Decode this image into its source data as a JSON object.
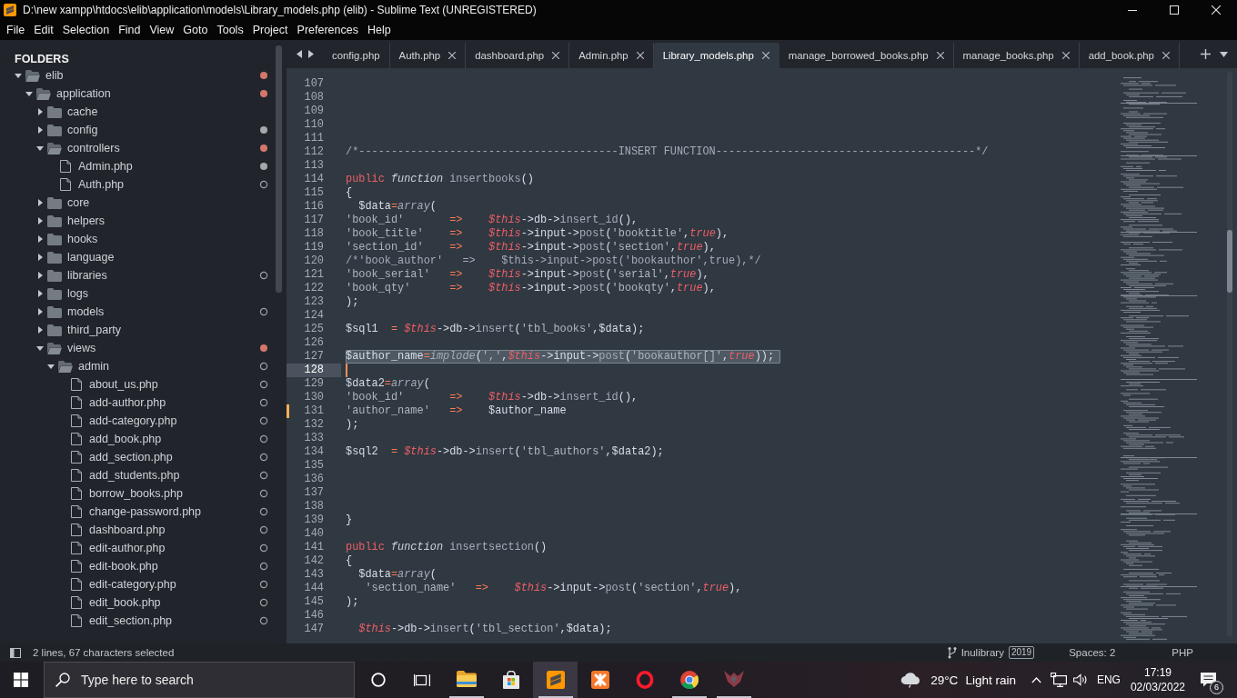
{
  "window": {
    "title": "D:\\new xampp\\htdocs\\elib\\application\\models\\Library_models.php (elib) - Sublime Text (UNREGISTERED)"
  },
  "menu": [
    "File",
    "Edit",
    "Selection",
    "Find",
    "View",
    "Goto",
    "Tools",
    "Project",
    "Preferences",
    "Help"
  ],
  "sidebar": {
    "title": "FOLDERS",
    "tree": [
      {
        "label": "elib",
        "kind": "folder",
        "expanded": true,
        "status_dot": {
          "color": "#d3776b",
          "filled": true
        },
        "children": [
          {
            "label": "application",
            "kind": "folder",
            "expanded": true,
            "status_dot": {
              "color": "#d3776b",
              "filled": true
            },
            "children": [
              {
                "label": "cache",
                "kind": "folder",
                "expanded": false
              },
              {
                "label": "config",
                "kind": "folder",
                "expanded": false,
                "status_dot": {
                  "color": "#a4a8ac",
                  "filled": true
                }
              },
              {
                "label": "controllers",
                "kind": "folder",
                "expanded": true,
                "status_dot": {
                  "color": "#d3776b",
                  "filled": true
                },
                "children": [
                  {
                    "label": "Admin.php",
                    "kind": "file",
                    "status_dot": {
                      "color": "#a4a8ac",
                      "filled": true
                    }
                  },
                  {
                    "label": "Auth.php",
                    "kind": "file",
                    "status_dot": {
                      "color": "#9aa0a6",
                      "filled": false
                    }
                  }
                ]
              },
              {
                "label": "core",
                "kind": "folder",
                "expanded": false
              },
              {
                "label": "helpers",
                "kind": "folder",
                "expanded": false
              },
              {
                "label": "hooks",
                "kind": "folder",
                "expanded": false
              },
              {
                "label": "language",
                "kind": "folder",
                "expanded": false
              },
              {
                "label": "libraries",
                "kind": "folder",
                "expanded": false,
                "status_dot": {
                  "color": "#9aa0a6",
                  "filled": false
                }
              },
              {
                "label": "logs",
                "kind": "folder",
                "expanded": false
              },
              {
                "label": "models",
                "kind": "folder",
                "expanded": false,
                "status_dot": {
                  "color": "#9aa0a6",
                  "filled": false
                }
              },
              {
                "label": "third_party",
                "kind": "folder",
                "expanded": false
              },
              {
                "label": "views",
                "kind": "folder",
                "expanded": true,
                "status_dot": {
                  "color": "#d3776b",
                  "filled": true
                },
                "children": [
                  {
                    "label": "admin",
                    "kind": "folder",
                    "expanded": true,
                    "status_dot": {
                      "color": "#9aa0a6",
                      "filled": false
                    },
                    "children": [
                      {
                        "label": "about_us.php",
                        "kind": "file",
                        "status_dot": {
                          "color": "#9aa0a6",
                          "filled": false
                        }
                      },
                      {
                        "label": "add-author.php",
                        "kind": "file",
                        "status_dot": {
                          "color": "#9aa0a6",
                          "filled": false
                        }
                      },
                      {
                        "label": "add-category.php",
                        "kind": "file",
                        "status_dot": {
                          "color": "#9aa0a6",
                          "filled": false
                        }
                      },
                      {
                        "label": "add_book.php",
                        "kind": "file",
                        "status_dot": {
                          "color": "#9aa0a6",
                          "filled": false
                        }
                      },
                      {
                        "label": "add_section.php",
                        "kind": "file",
                        "status_dot": {
                          "color": "#9aa0a6",
                          "filled": false
                        }
                      },
                      {
                        "label": "add_students.php",
                        "kind": "file",
                        "status_dot": {
                          "color": "#9aa0a6",
                          "filled": false
                        }
                      },
                      {
                        "label": "borrow_books.php",
                        "kind": "file",
                        "status_dot": {
                          "color": "#9aa0a6",
                          "filled": false
                        }
                      },
                      {
                        "label": "change-password.php",
                        "kind": "file",
                        "status_dot": {
                          "color": "#9aa0a6",
                          "filled": false
                        }
                      },
                      {
                        "label": "dashboard.php",
                        "kind": "file",
                        "status_dot": {
                          "color": "#9aa0a6",
                          "filled": false
                        }
                      },
                      {
                        "label": "edit-author.php",
                        "kind": "file",
                        "status_dot": {
                          "color": "#9aa0a6",
                          "filled": false
                        }
                      },
                      {
                        "label": "edit-book.php",
                        "kind": "file",
                        "status_dot": {
                          "color": "#9aa0a6",
                          "filled": false
                        }
                      },
                      {
                        "label": "edit-category.php",
                        "kind": "file",
                        "status_dot": {
                          "color": "#9aa0a6",
                          "filled": false
                        }
                      },
                      {
                        "label": "edit_book.php",
                        "kind": "file",
                        "status_dot": {
                          "color": "#9aa0a6",
                          "filled": false
                        }
                      },
                      {
                        "label": "edit_section.php",
                        "kind": "file",
                        "status_dot": {
                          "color": "#9aa0a6",
                          "filled": false
                        }
                      }
                    ]
                  }
                ]
              }
            ]
          }
        ]
      }
    ]
  },
  "tabs": [
    {
      "label": "config.php",
      "selected": false,
      "close_button": false
    },
    {
      "label": "Auth.php",
      "selected": false,
      "close_button": true
    },
    {
      "label": "dashboard.php",
      "selected": false,
      "close_button": true
    },
    {
      "label": "Admin.php",
      "selected": false,
      "close_button": true
    },
    {
      "label": "Library_models.php",
      "selected": true,
      "close_button": true
    },
    {
      "label": "manage_borrowed_books.php",
      "selected": false,
      "close_button": true
    },
    {
      "label": "manage_books.php",
      "selected": false,
      "close_button": true
    },
    {
      "label": "add_book.php",
      "selected": false,
      "close_button": true
    }
  ],
  "editor": {
    "lines": [
      {
        "number": "107",
        "selected": false,
        "caret": false,
        "modified": false
      },
      {
        "number": "108",
        "selected": false,
        "caret": false,
        "modified": false
      },
      {
        "number": "109",
        "selected": false,
        "caret": false,
        "modified": false
      },
      {
        "number": "110",
        "selected": false,
        "caret": false,
        "modified": false
      },
      {
        "number": "111",
        "selected": false,
        "caret": false,
        "modified": false
      },
      {
        "number": "112",
        "selected": false,
        "caret": false,
        "modified": false,
        "tokens": [
          {
            "text": "/*----------------------------------------INSERT FUNCTION----------------------------------------*/",
            "kind": "comment"
          }
        ]
      },
      {
        "number": "113",
        "selected": false,
        "caret": false,
        "modified": false
      },
      {
        "number": "114",
        "selected": false,
        "caret": false,
        "modified": false,
        "tokens": [
          {
            "text": "public ",
            "kind": "keyword"
          },
          {
            "text": "function ",
            "kind": "storage"
          },
          {
            "text": "insertbooks",
            "kind": "entity"
          },
          {
            "text": "()",
            "kind": "plain"
          }
        ]
      },
      {
        "number": "115",
        "selected": false,
        "caret": false,
        "modified": false,
        "tokens": [
          {
            "text": "{",
            "kind": "plain"
          }
        ]
      },
      {
        "number": "116",
        "selected": false,
        "caret": false,
        "modified": false,
        "tokens": [
          {
            "text": "  $data",
            "kind": "plain"
          },
          {
            "text": "=",
            "kind": "operator"
          },
          {
            "text": "array",
            "kind": "support"
          },
          {
            "text": "(",
            "kind": "plain"
          }
        ]
      },
      {
        "number": "117",
        "selected": false,
        "caret": false,
        "modified": false,
        "tokens": [
          {
            "text": "'book_id'       ",
            "kind": "string"
          },
          {
            "text": "=>    ",
            "kind": "operator"
          },
          {
            "text": "$this",
            "kind": "this"
          },
          {
            "text": "->db->",
            "kind": "plain"
          },
          {
            "text": "insert_id",
            "kind": "method"
          },
          {
            "text": "(),",
            "kind": "plain"
          }
        ]
      },
      {
        "number": "118",
        "selected": false,
        "caret": false,
        "modified": false,
        "tokens": [
          {
            "text": "'book_title'    ",
            "kind": "string"
          },
          {
            "text": "=>    ",
            "kind": "operator"
          },
          {
            "text": "$this",
            "kind": "this"
          },
          {
            "text": "->input->",
            "kind": "plain"
          },
          {
            "text": "post",
            "kind": "method"
          },
          {
            "text": "(",
            "kind": "plain"
          },
          {
            "text": "'booktitle'",
            "kind": "string"
          },
          {
            "text": ",",
            "kind": "plain"
          },
          {
            "text": "true",
            "kind": "constant"
          },
          {
            "text": "),",
            "kind": "plain"
          }
        ]
      },
      {
        "number": "119",
        "selected": false,
        "caret": false,
        "modified": false,
        "tokens": [
          {
            "text": "'section_id'    ",
            "kind": "string"
          },
          {
            "text": "=>    ",
            "kind": "operator"
          },
          {
            "text": "$this",
            "kind": "this"
          },
          {
            "text": "->input->",
            "kind": "plain"
          },
          {
            "text": "post",
            "kind": "method"
          },
          {
            "text": "(",
            "kind": "plain"
          },
          {
            "text": "'section'",
            "kind": "string"
          },
          {
            "text": ",",
            "kind": "plain"
          },
          {
            "text": "true",
            "kind": "constant"
          },
          {
            "text": "),",
            "kind": "plain"
          }
        ]
      },
      {
        "number": "120",
        "selected": false,
        "caret": false,
        "modified": false,
        "tokens": [
          {
            "text": "/*'book_author'   =>    $this->input->post('bookauthor',true),*/",
            "kind": "comment"
          }
        ]
      },
      {
        "number": "121",
        "selected": false,
        "caret": false,
        "modified": false,
        "tokens": [
          {
            "text": "'book_serial'   ",
            "kind": "string"
          },
          {
            "text": "=>    ",
            "kind": "operator"
          },
          {
            "text": "$this",
            "kind": "this"
          },
          {
            "text": "->input->",
            "kind": "plain"
          },
          {
            "text": "post",
            "kind": "method"
          },
          {
            "text": "(",
            "kind": "plain"
          },
          {
            "text": "'serial'",
            "kind": "string"
          },
          {
            "text": ",",
            "kind": "plain"
          },
          {
            "text": "true",
            "kind": "constant"
          },
          {
            "text": "),",
            "kind": "plain"
          }
        ]
      },
      {
        "number": "122",
        "selected": false,
        "caret": false,
        "modified": false,
        "tokens": [
          {
            "text": "'book_qty'      ",
            "kind": "string"
          },
          {
            "text": "=>    ",
            "kind": "operator"
          },
          {
            "text": "$this",
            "kind": "this"
          },
          {
            "text": "->input->",
            "kind": "plain"
          },
          {
            "text": "post",
            "kind": "method"
          },
          {
            "text": "(",
            "kind": "plain"
          },
          {
            "text": "'bookqty'",
            "kind": "string"
          },
          {
            "text": ",",
            "kind": "plain"
          },
          {
            "text": "true",
            "kind": "constant"
          },
          {
            "text": "),",
            "kind": "plain"
          }
        ]
      },
      {
        "number": "123",
        "selected": false,
        "caret": false,
        "modified": false,
        "tokens": [
          {
            "text": ");",
            "kind": "plain"
          }
        ]
      },
      {
        "number": "124",
        "selected": false,
        "caret": false,
        "modified": false
      },
      {
        "number": "125",
        "selected": false,
        "caret": false,
        "modified": false,
        "tokens": [
          {
            "text": "$sql1  ",
            "kind": "plain"
          },
          {
            "text": "= ",
            "kind": "operator"
          },
          {
            "text": "$this",
            "kind": "this"
          },
          {
            "text": "->db->",
            "kind": "plain"
          },
          {
            "text": "insert",
            "kind": "method"
          },
          {
            "text": "(",
            "kind": "plain"
          },
          {
            "text": "'tbl_books'",
            "kind": "string"
          },
          {
            "text": ",$data);",
            "kind": "plain"
          }
        ]
      },
      {
        "number": "126",
        "selected": false,
        "caret": false,
        "modified": false
      },
      {
        "number": "127",
        "selected": true,
        "caret": false,
        "modified": false,
        "tokens": [
          {
            "text": "$author_name",
            "kind": "plain"
          },
          {
            "text": "=",
            "kind": "operator"
          },
          {
            "text": "implode",
            "kind": "support"
          },
          {
            "text": "(",
            "kind": "plain"
          },
          {
            "text": "','",
            "kind": "string"
          },
          {
            "text": ",",
            "kind": "plain"
          },
          {
            "text": "$this",
            "kind": "this"
          },
          {
            "text": "->input->",
            "kind": "plain"
          },
          {
            "text": "post",
            "kind": "method"
          },
          {
            "text": "(",
            "kind": "plain"
          },
          {
            "text": "'bookauthor[]'",
            "kind": "string"
          },
          {
            "text": ",",
            "kind": "plain"
          },
          {
            "text": "true",
            "kind": "constant"
          },
          {
            "text": "));",
            "kind": "plain"
          }
        ]
      },
      {
        "number": "128",
        "selected": false,
        "caret": true,
        "modified": false
      },
      {
        "number": "129",
        "selected": false,
        "caret": false,
        "modified": false,
        "tokens": [
          {
            "text": "$data2",
            "kind": "plain"
          },
          {
            "text": "=",
            "kind": "operator"
          },
          {
            "text": "array",
            "kind": "support"
          },
          {
            "text": "(",
            "kind": "plain"
          }
        ]
      },
      {
        "number": "130",
        "selected": false,
        "caret": false,
        "modified": false,
        "tokens": [
          {
            "text": "'book_id'       ",
            "kind": "string"
          },
          {
            "text": "=>    ",
            "kind": "operator"
          },
          {
            "text": "$this",
            "kind": "this"
          },
          {
            "text": "->db->",
            "kind": "plain"
          },
          {
            "text": "insert_id",
            "kind": "method"
          },
          {
            "text": "(),",
            "kind": "plain"
          }
        ]
      },
      {
        "number": "131",
        "selected": false,
        "caret": false,
        "modified": true,
        "tokens": [
          {
            "text": "'author_name'   ",
            "kind": "string"
          },
          {
            "text": "=>    ",
            "kind": "operator"
          },
          {
            "text": "$author_name",
            "kind": "plain"
          }
        ]
      },
      {
        "number": "132",
        "selected": false,
        "caret": false,
        "modified": false,
        "tokens": [
          {
            "text": ");",
            "kind": "plain"
          }
        ]
      },
      {
        "number": "133",
        "selected": false,
        "caret": false,
        "modified": false
      },
      {
        "number": "134",
        "selected": false,
        "caret": false,
        "modified": false,
        "tokens": [
          {
            "text": "$sql2  ",
            "kind": "plain"
          },
          {
            "text": "= ",
            "kind": "operator"
          },
          {
            "text": "$this",
            "kind": "this"
          },
          {
            "text": "->db->",
            "kind": "plain"
          },
          {
            "text": "insert",
            "kind": "method"
          },
          {
            "text": "(",
            "kind": "plain"
          },
          {
            "text": "'tbl_authors'",
            "kind": "string"
          },
          {
            "text": ",$data2);",
            "kind": "plain"
          }
        ]
      },
      {
        "number": "135",
        "selected": false,
        "caret": false,
        "modified": false
      },
      {
        "number": "136",
        "selected": false,
        "caret": false,
        "modified": false
      },
      {
        "number": "137",
        "selected": false,
        "caret": false,
        "modified": false
      },
      {
        "number": "138",
        "selected": false,
        "caret": false,
        "modified": false
      },
      {
        "number": "139",
        "selected": false,
        "caret": false,
        "modified": false,
        "tokens": [
          {
            "text": "}",
            "kind": "plain"
          }
        ]
      },
      {
        "number": "140",
        "selected": false,
        "caret": false,
        "modified": false
      },
      {
        "number": "141",
        "selected": false,
        "caret": false,
        "modified": false,
        "tokens": [
          {
            "text": "public ",
            "kind": "keyword"
          },
          {
            "text": "function ",
            "kind": "storage"
          },
          {
            "text": "insertsection",
            "kind": "entity"
          },
          {
            "text": "()",
            "kind": "plain"
          }
        ]
      },
      {
        "number": "142",
        "selected": false,
        "caret": false,
        "modified": false,
        "tokens": [
          {
            "text": "{",
            "kind": "plain"
          }
        ]
      },
      {
        "number": "143",
        "selected": false,
        "caret": false,
        "modified": false,
        "tokens": [
          {
            "text": "  $data",
            "kind": "plain"
          },
          {
            "text": "=",
            "kind": "operator"
          },
          {
            "text": "array",
            "kind": "support"
          },
          {
            "text": "(",
            "kind": "plain"
          }
        ]
      },
      {
        "number": "144",
        "selected": false,
        "caret": false,
        "modified": false,
        "tokens": [
          {
            "text": "   'section_name'   ",
            "kind": "string"
          },
          {
            "text": "=>    ",
            "kind": "operator"
          },
          {
            "text": "$this",
            "kind": "this"
          },
          {
            "text": "->input->",
            "kind": "plain"
          },
          {
            "text": "post",
            "kind": "method"
          },
          {
            "text": "(",
            "kind": "plain"
          },
          {
            "text": "'section'",
            "kind": "string"
          },
          {
            "text": ",",
            "kind": "plain"
          },
          {
            "text": "true",
            "kind": "constant"
          },
          {
            "text": "),",
            "kind": "plain"
          }
        ]
      },
      {
        "number": "145",
        "selected": false,
        "caret": false,
        "modified": false,
        "tokens": [
          {
            "text": ");",
            "kind": "plain"
          }
        ]
      },
      {
        "number": "146",
        "selected": false,
        "caret": false,
        "modified": false
      },
      {
        "number": "147",
        "selected": false,
        "caret": false,
        "modified": false,
        "tokens": [
          {
            "text": "  $this",
            "kind": "this"
          },
          {
            "text": "->db->",
            "kind": "plain"
          },
          {
            "text": "insert",
            "kind": "method"
          },
          {
            "text": "(",
            "kind": "plain"
          },
          {
            "text": "'tbl_section'",
            "kind": "string"
          },
          {
            "text": ",$data);",
            "kind": "plain"
          }
        ]
      }
    ]
  },
  "status_bar": {
    "selection": "2 lines, 67 characters selected",
    "branch": "Inulibrary",
    "changes": "2019",
    "indentation": "Spaces: 2",
    "syntax": "PHP"
  },
  "taskbar": {
    "search": {
      "placeholder": "Type here to search"
    },
    "apps": [
      {
        "kind": "file-explorer",
        "running": true,
        "selected": false
      },
      {
        "kind": "store",
        "running": false,
        "selected": false
      },
      {
        "kind": "sublime-text",
        "running": true,
        "selected": true
      },
      {
        "kind": "xampp",
        "running": false,
        "selected": false
      },
      {
        "kind": "opera",
        "running": false,
        "selected": false
      },
      {
        "kind": "chrome",
        "running": true,
        "selected": false
      },
      {
        "kind": "wing-logo",
        "running": true,
        "selected": false
      }
    ],
    "weather": {
      "temperature": "29°C",
      "condition": "Light rain"
    },
    "language": "ENG",
    "clock": {
      "time": "17:19",
      "date": "02/03/2022"
    },
    "notification_count": "6"
  }
}
